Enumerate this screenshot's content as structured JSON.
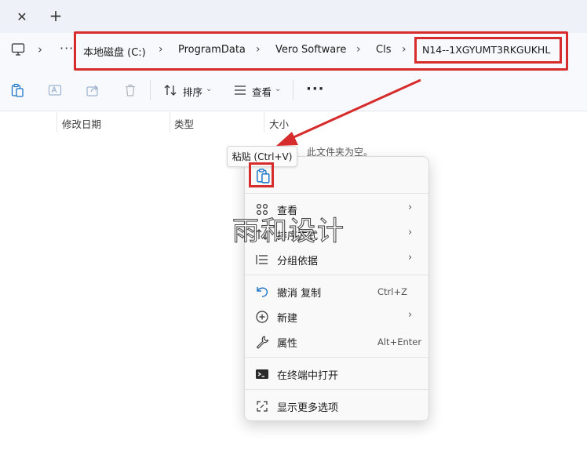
{
  "tabstrip": {
    "close_glyph": "✕",
    "add_glyph": "+"
  },
  "address": {
    "more_glyph": "···",
    "crumbs": [
      "本地磁盘 (C:)",
      "ProgramData",
      "Vero Software",
      "Cls",
      "N14--1XGYUMT3RKGUKHL"
    ]
  },
  "toolbar": {
    "sort_label": "排序",
    "view_label": "查看",
    "more_glyph": "···",
    "icons": [
      "paste-icon",
      "rename-icon",
      "share-icon",
      "delete-icon"
    ]
  },
  "columns": [
    "修改日期",
    "类型",
    "大小"
  ],
  "empty_message": "此文件夹为空。",
  "tooltip": "粘贴 (Ctrl+V)",
  "watermark": "雨和设计",
  "menu": {
    "items": [
      {
        "label": "查看",
        "icon": "grid-icon",
        "submenu": true
      },
      {
        "label": "排序方式",
        "icon": "sort-icon",
        "submenu": true
      },
      {
        "label": "分组依据",
        "icon": "group-icon",
        "submenu": true
      },
      {
        "label": "撤消 复制",
        "icon": "undo-icon",
        "shortcut": "Ctrl+Z"
      },
      {
        "label": "新建",
        "icon": "new-icon",
        "submenu": true
      },
      {
        "label": "属性",
        "icon": "wrench-icon",
        "shortcut": "Alt+Enter"
      },
      {
        "label": "在终端中打开",
        "icon": "terminal-icon"
      },
      {
        "label": "显示更多选项",
        "icon": "expand-icon"
      }
    ]
  },
  "colors": {
    "highlight_red": "#d62c2c",
    "accent_blue": "#1a73c8"
  }
}
